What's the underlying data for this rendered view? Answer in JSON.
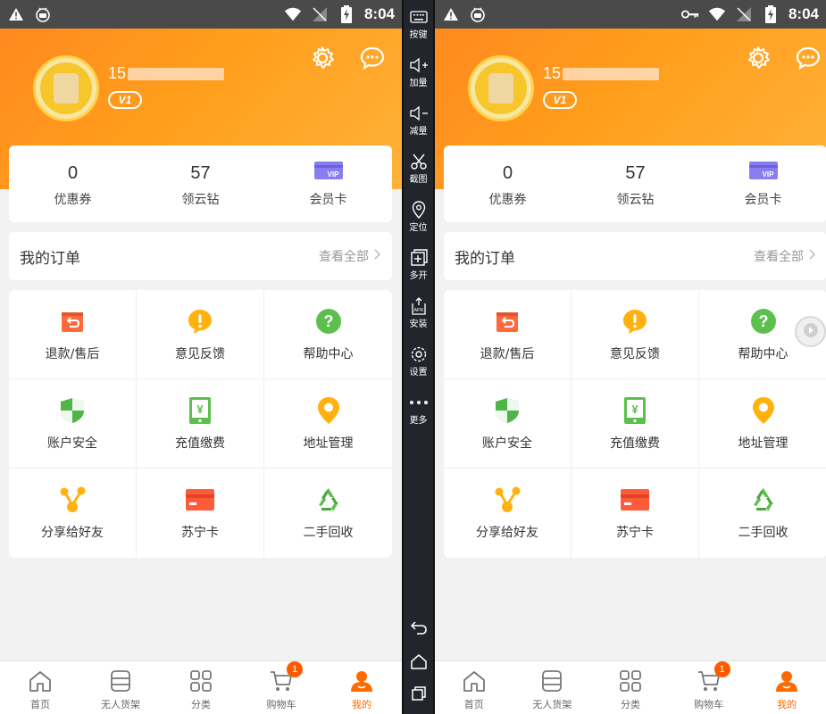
{
  "status_bar": {
    "time": "8:04"
  },
  "profile": {
    "phone_prefix": "15",
    "level_badge": "V1"
  },
  "stats": [
    {
      "value": "0",
      "label": "优惠券"
    },
    {
      "value": "57",
      "label": "领云钻"
    },
    {
      "value": "",
      "label": "会员卡",
      "icon_text": "VIP"
    }
  ],
  "orders": {
    "title": "我的订单",
    "view_all": "查看全部"
  },
  "grid": [
    {
      "label": "退款/售后",
      "icon": "refund-icon"
    },
    {
      "label": "意见反馈",
      "icon": "feedback-icon"
    },
    {
      "label": "帮助中心",
      "icon": "help-icon"
    },
    {
      "label": "账户安全",
      "icon": "shield-icon"
    },
    {
      "label": "充值缴费",
      "icon": "recharge-icon"
    },
    {
      "label": "地址管理",
      "icon": "location-icon"
    },
    {
      "label": "分享给好友",
      "icon": "share-icon"
    },
    {
      "label": "苏宁卡",
      "icon": "card-icon"
    },
    {
      "label": "二手回收",
      "icon": "recycle-icon"
    }
  ],
  "tabbar": [
    {
      "label": "首页",
      "icon": "home-icon"
    },
    {
      "label": "无人货架",
      "icon": "shelf-icon"
    },
    {
      "label": "分类",
      "icon": "category-icon"
    },
    {
      "label": "购物车",
      "icon": "cart-icon",
      "badge": "1"
    },
    {
      "label": "我的",
      "icon": "profile-icon",
      "active": true
    }
  ],
  "emulator_tools": [
    {
      "label": "按键",
      "icon": "keyboard-icon"
    },
    {
      "label": "加量",
      "icon": "volume-up-icon"
    },
    {
      "label": "减量",
      "icon": "volume-down-icon"
    },
    {
      "label": "截图",
      "icon": "scissors-icon"
    },
    {
      "label": "定位",
      "icon": "location-pin-icon"
    },
    {
      "label": "多开",
      "icon": "multi-instance-icon"
    },
    {
      "label": "安装",
      "icon": "apk-install-icon"
    },
    {
      "label": "设置",
      "icon": "settings-icon"
    },
    {
      "label": "更多",
      "icon": "more-icon"
    }
  ],
  "colors": {
    "accent": "#ff8a1f",
    "active_tab": "#ff6a00",
    "badge": "#ff5a00"
  }
}
